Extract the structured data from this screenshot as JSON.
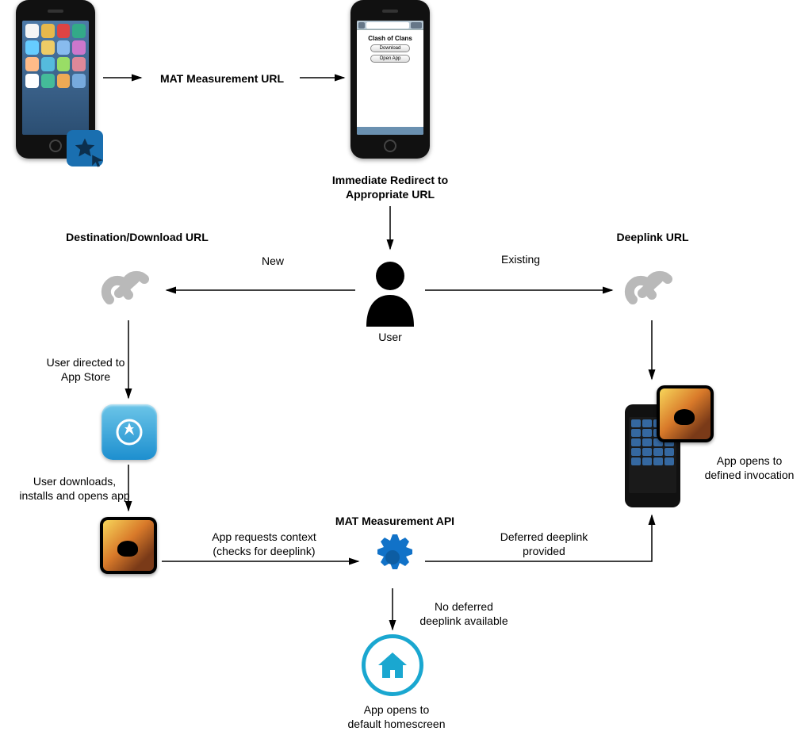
{
  "top": {
    "mat_url_label": "MAT Measurement URL",
    "redirect_label_1": "Immediate Redirect to",
    "redirect_label_2": "Appropriate URL",
    "browser_title": "Clash of Clans",
    "browser_btn_download": "Download",
    "browser_btn_open": "Open App"
  },
  "user": {
    "label": "User",
    "left_branch": "New",
    "right_branch": "Existing"
  },
  "left": {
    "dest_label": "Destination/Download URL",
    "to_store": "User directed to\nApp Store",
    "install": "User downloads,\ninstalls and opens app"
  },
  "right": {
    "deeplink_label": "Deeplink URL",
    "open_invocation_1": "App opens to",
    "open_invocation_2": "defined invocation"
  },
  "center": {
    "api_label": "MAT Measurement API",
    "req_context_1": "App requests context",
    "req_context_2": "(checks for deeplink)",
    "deferred_provided": "Deferred deeplink\nprovided",
    "no_deferred_1": "No deferred",
    "no_deferred_2": "deeplink available",
    "default_home_1": "App opens to",
    "default_home_2": "default homescreen"
  }
}
